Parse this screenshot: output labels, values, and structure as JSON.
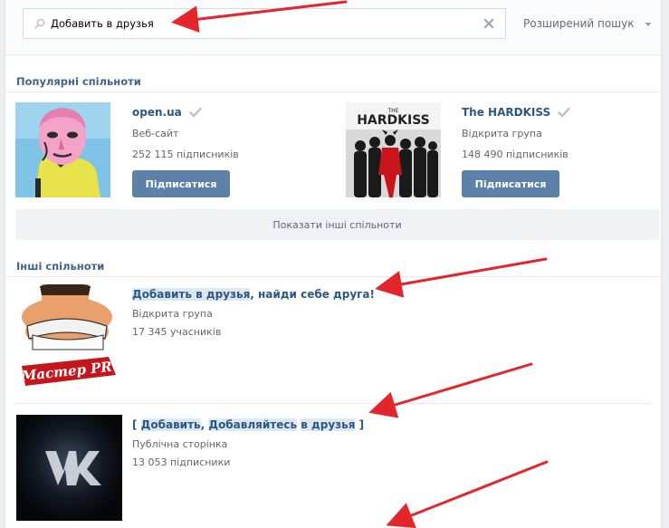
{
  "search": {
    "value": "Добавить в друзья",
    "placeholder": "",
    "advanced_label": "Розширений пошук"
  },
  "popular": {
    "title": "Популярні спільноти",
    "items": [
      {
        "name": "open.ua",
        "type": "Веб-сайт",
        "count": "252 115 підписників",
        "button": "Підписатися",
        "verified": true
      },
      {
        "name": "The HARDKISS",
        "type": "Відкрита група",
        "count": "148 490 підписників",
        "button": "Підписатися",
        "verified": true,
        "logo_text": "HARDKISS",
        "logo_small": "THE"
      }
    ],
    "show_more": "Показати інші спільноти"
  },
  "others": {
    "title": "Інші спільноти",
    "items": [
      {
        "name_parts": [
          "Добавить в друзья",
          ", найди себе друга!"
        ],
        "type": "Відкрита група",
        "count": "17 345 учасників",
        "logo_text": "Мастер PR"
      },
      {
        "name_parts": [
          "[ ",
          "Добавить",
          ", ",
          "Добавляйтесь",
          " ",
          "в друзья",
          " ]"
        ],
        "type": "Публічна сторінка",
        "count": "13 053 підписники",
        "logo_text": "VK"
      }
    ]
  },
  "colors": {
    "link": "#2a5885",
    "section": "#42648b",
    "button": "#5e81a8",
    "annotation": "#e3262b"
  }
}
